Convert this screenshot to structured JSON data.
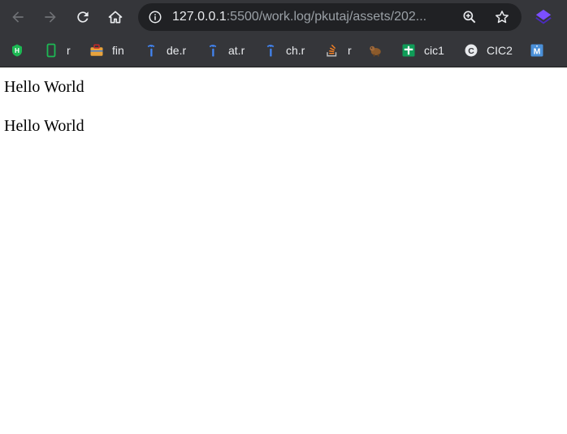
{
  "browser": {
    "url_host": "127.0.0.1",
    "url_rest": ":5500/work.log/pkutaj/assets/202...",
    "icons": {
      "back": "arrow-left-icon",
      "forward": "arrow-right-icon",
      "reload": "reload-icon",
      "home": "home-icon",
      "site_info": "info-icon",
      "zoom": "zoom-in-icon",
      "bookmark_star": "star-icon",
      "extension": "layers-extension-icon"
    },
    "colors": {
      "chrome_bg": "#35363a",
      "omnibox_bg": "#202124",
      "text": "#e8eaed",
      "muted": "#9aa0a6"
    }
  },
  "bookmarks": [
    {
      "label": "",
      "icon": "h-shield-icon",
      "color": "#1db954"
    },
    {
      "label": "r",
      "icon": "phone-outline-icon",
      "color": "#1db954"
    },
    {
      "label": "fin",
      "icon": "briefcase-icon",
      "color": "#e8a33c"
    },
    {
      "label": "de.r",
      "icon": "i-bracket-icon",
      "color": "#4285f4"
    },
    {
      "label": "at.r",
      "icon": "i-bracket-icon",
      "color": "#4285f4"
    },
    {
      "label": "ch.r",
      "icon": "i-bracket-icon",
      "color": "#4285f4"
    },
    {
      "label": "r",
      "icon": "stack-overflow-icon",
      "color": "#f48024"
    },
    {
      "label": "",
      "icon": "animal-icon",
      "color": "#8b5a2b"
    },
    {
      "label": "cic1",
      "icon": "green-plus-icon",
      "color": "#0f9d58"
    },
    {
      "label": "CIC2",
      "icon": "c-circle-icon",
      "color": "#e8eaed"
    },
    {
      "label": "",
      "icon": "m-square-icon",
      "color": "#4a90d9"
    }
  ],
  "page": {
    "lines": [
      "Hello World",
      "Hello World"
    ]
  }
}
